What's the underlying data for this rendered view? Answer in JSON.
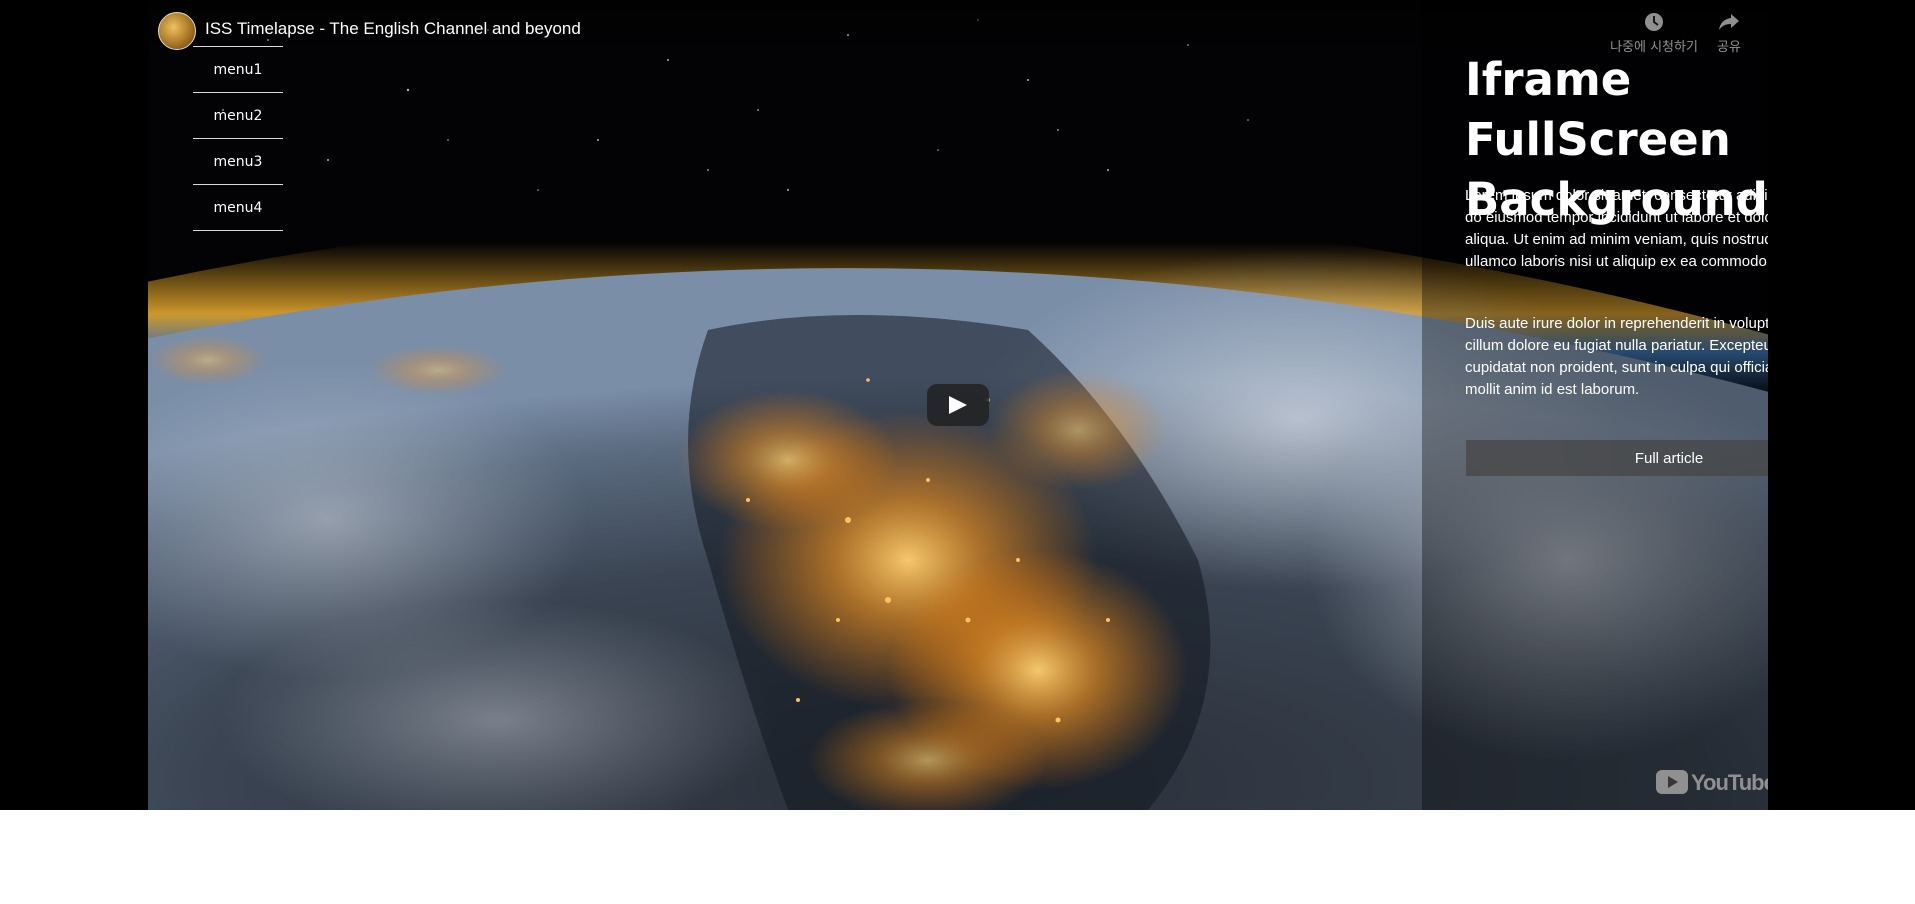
{
  "video": {
    "title": "ISS Timelapse - The English Channel and beyond",
    "watch_later_label": "나중에 시청하기",
    "share_label": "공유",
    "logo_text": "YouTube"
  },
  "menu": {
    "items": [
      {
        "label": "menu1"
      },
      {
        "label": "menu2"
      },
      {
        "label": "menu3"
      },
      {
        "label": "menu4"
      }
    ]
  },
  "panel": {
    "title": "Iframe FullScreen Background",
    "paragraph1": "Lorem ipsum dolor sit amet, consectetur adipiscing elit, sed do eiusmod tempor incididunt ut labore et dolore magna aliqua. Ut enim ad minim veniam, quis nostrud exercitation ullamco laboris nisi ut aliquip ex ea commodo consequat.",
    "paragraph2": "Duis aute irure dolor in reprehenderit in voluptate velit esse cillum dolore eu fugiat nulla pariatur. Excepteur sint occaecat cupidatat non proident, sunt in culpa qui officia deserunt mollit anim id est laborum.",
    "button_label": "Full article"
  },
  "colors": {
    "stage_background": "#000000",
    "page_background": "#ffffff",
    "city_lights": "#ffa830",
    "atmosphere": "#e0a020"
  },
  "icons": [
    "channel-avatar",
    "clock-icon",
    "share-icon",
    "play-icon",
    "youtube-logo-icon"
  ]
}
